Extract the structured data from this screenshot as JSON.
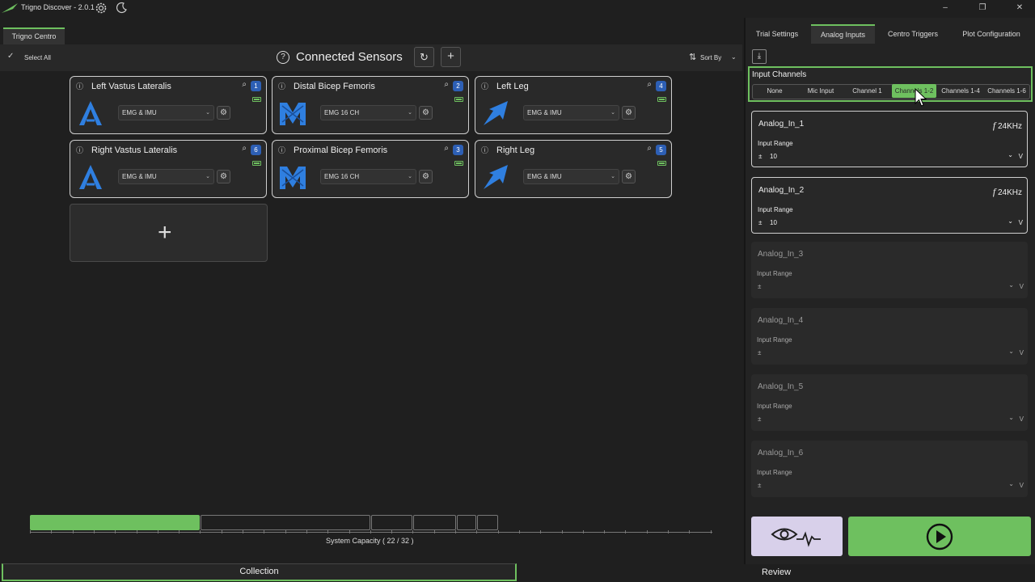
{
  "app": {
    "title": "Trigno Discover - 2.0.1"
  },
  "tabs": {
    "centro": "Trigno Centro"
  },
  "toolbar": {
    "select_all": "Select All",
    "heading": "Connected Sensors",
    "sort_by": "Sort By"
  },
  "sensors": [
    {
      "name": "Left Vastus Lateralis",
      "number": "1",
      "mode": "EMG & IMU",
      "icon": "avanti-sensor-logo"
    },
    {
      "name": "Distal Bicep Femoris",
      "number": "2",
      "mode": "EMG 16 CH",
      "icon": "maize-sensor-logo"
    },
    {
      "name": "Left Leg",
      "number": "4",
      "mode": "EMG & IMU",
      "icon": "arrow-sensor-logo"
    },
    {
      "name": "Right Vastus Lateralis",
      "number": "6",
      "mode": "EMG & IMU",
      "icon": "avanti-sensor-logo"
    },
    {
      "name": "Proximal Bicep Femoris",
      "number": "3",
      "mode": "EMG 16 CH",
      "icon": "maize-sensor-logo"
    },
    {
      "name": "Right Leg",
      "number": "5",
      "mode": "EMG & IMU",
      "icon": "arrow-sensor-logo"
    }
  ],
  "capacity": {
    "label": "System Capacity ( 22 / 32 )",
    "used": 22,
    "total": 32
  },
  "right_tabs": [
    "Trial Settings",
    "Analog Inputs",
    "Centro Triggers",
    "Plot Configuration"
  ],
  "input_channels": {
    "title": "Input Channels",
    "options": [
      "None",
      "Mic Input",
      "Channel 1",
      "Channels 1-2",
      "Channels 1-4",
      "Channels 1-6"
    ],
    "selected": "Channels 1-2"
  },
  "analog": [
    {
      "name": "Analog_In_1",
      "input_range": "Input Range",
      "pm": "±",
      "value": "10",
      "unit": "V",
      "freq_symbol": "f",
      "freq": "24KHz"
    },
    {
      "name": "Analog_In_2",
      "input_range": "Input Range",
      "pm": "±",
      "value": "10",
      "unit": "V",
      "freq_symbol": "f",
      "freq": "24KHz"
    },
    {
      "name": "Analog_In_3",
      "input_range": "Input Range",
      "pm": "±",
      "unit": "V"
    },
    {
      "name": "Analog_In_4",
      "input_range": "Input Range",
      "pm": "±",
      "unit": "V"
    },
    {
      "name": "Analog_In_5",
      "input_range": "Input Range",
      "pm": "±",
      "unit": "V"
    },
    {
      "name": "Analog_In_6",
      "input_range": "Input Range",
      "pm": "±",
      "unit": "V"
    }
  ],
  "bottom_tabs": {
    "collection": "Collection",
    "review": "Review"
  },
  "colors": {
    "accent": "#6ec05f",
    "badge": "#2d5fb5",
    "sensor_blue": "#2f7fe0",
    "preview_button": "#d8d0ea",
    "start_button": "#6ec05f"
  }
}
